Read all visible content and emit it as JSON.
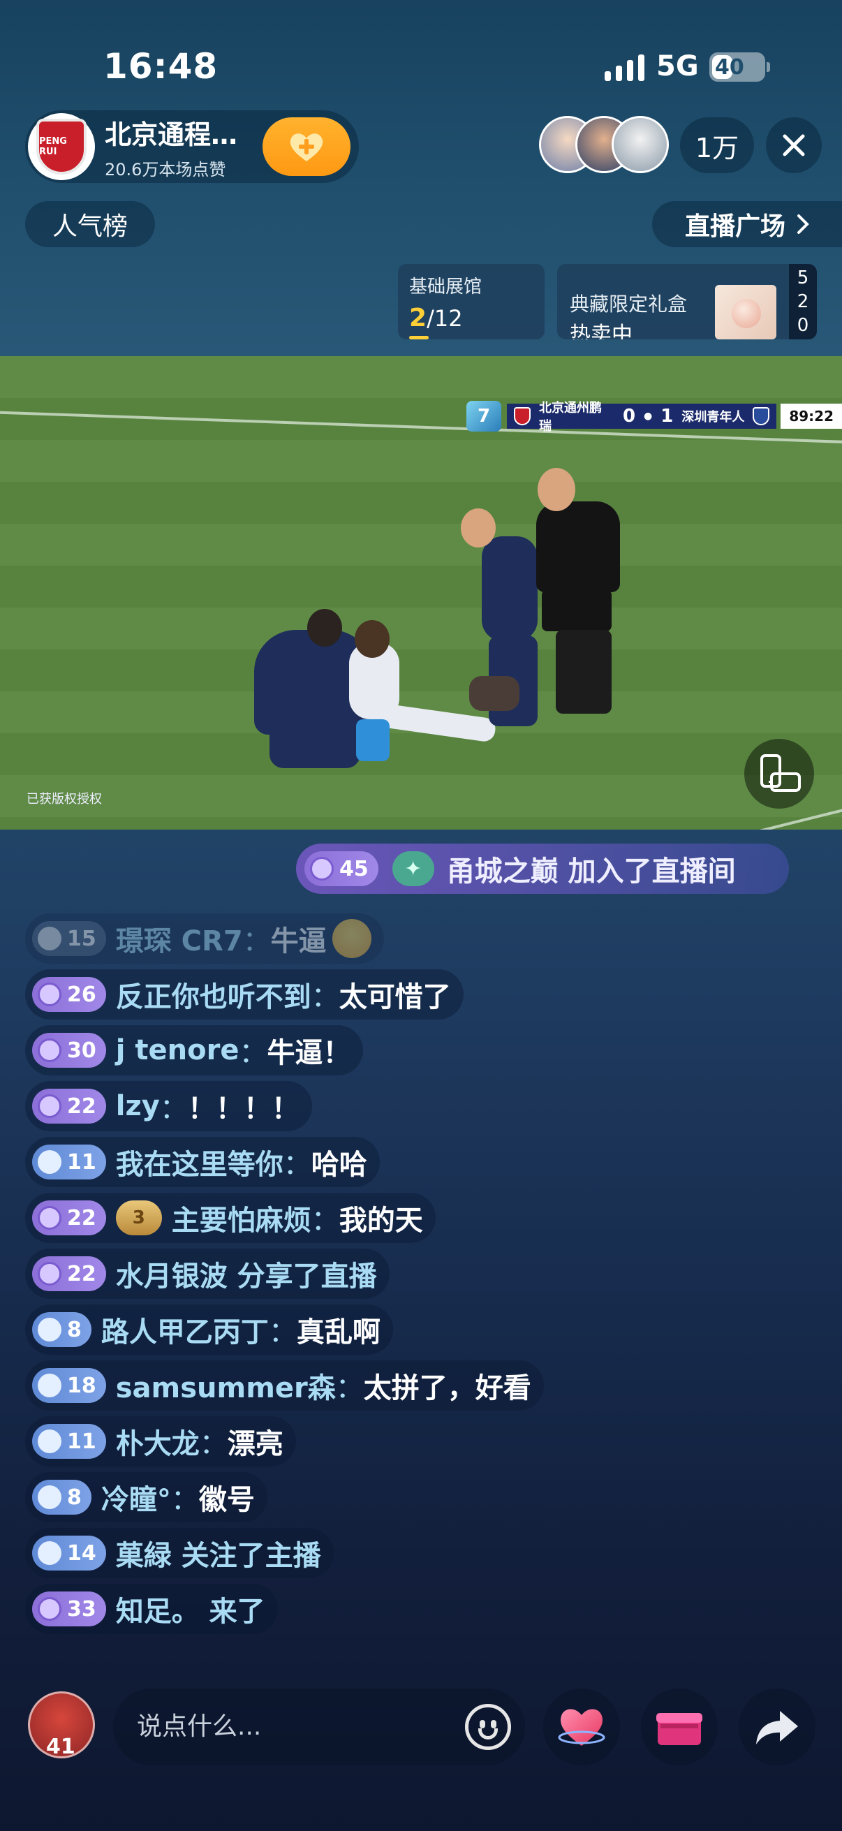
{
  "status": {
    "time": "16:48",
    "network": "5G",
    "battery": "40",
    "battery_level": 0.4
  },
  "host": {
    "name": "北京通程…",
    "likes": "20.6万本场点赞",
    "crest_text": "PENG RUI"
  },
  "viewers": {
    "count": "1万"
  },
  "nav": {
    "popularity": "人气榜",
    "plaza": "直播广场"
  },
  "hall_card": {
    "title": "基础展馆",
    "current": "2",
    "total": "/12"
  },
  "gift_card": {
    "title": "典藏限定礼盒",
    "status": "热卖中",
    "side": [
      "5",
      "2",
      "0"
    ]
  },
  "video": {
    "scorebug": {
      "home": "北京通州鹏瑞",
      "score_home": "0",
      "score_away": "1",
      "away": "深圳青年人",
      "clock": "89:22",
      "logo": "7"
    },
    "copyright": "已获版权授权"
  },
  "join_banner": {
    "level": "45",
    "text": "甬城之巅 加入了直播间"
  },
  "chat": [
    {
      "level": "15",
      "tier": "grey",
      "name": "璟琛 CR7",
      "sep": "：",
      "content": "牛逼",
      "faded": true
    },
    {
      "level": "26",
      "tier": "purple",
      "name": "反正你也听不到",
      "sep": "：",
      "content": "太可惜了"
    },
    {
      "level": "30",
      "tier": "purple",
      "name": "j tenore",
      "sep": "：",
      "content": "牛逼！"
    },
    {
      "level": "22",
      "tier": "purple",
      "name": "lzy",
      "sep": "：",
      "content": "！！！！"
    },
    {
      "level": "11",
      "tier": "blue",
      "name": "我在这里等你",
      "sep": "：",
      "content": "哈哈"
    },
    {
      "level": "22",
      "tier": "purple",
      "fan": "3",
      "name": "主要怕麻烦",
      "sep": "：",
      "content": "我的天"
    },
    {
      "level": "22",
      "tier": "purple",
      "name": "水月银波",
      "sep": "",
      "content": "",
      "system": " 分享了直播"
    },
    {
      "level": "8",
      "tier": "blue",
      "name": "路人甲乙丙丁",
      "sep": "：",
      "content": "真乱啊"
    },
    {
      "level": "18",
      "tier": "blue",
      "name": "samsummer森",
      "sep": "：",
      "content": "太拼了，好看"
    },
    {
      "level": "11",
      "tier": "blue",
      "name": "朴大龙",
      "sep": "：",
      "content": "漂亮"
    },
    {
      "level": "8",
      "tier": "blue",
      "name": "冷瞳°",
      "sep": "：",
      "content": "徽号"
    },
    {
      "level": "14",
      "tier": "blue",
      "name": "菓緑",
      "sep": "",
      "content": "",
      "system": " 关注了主播"
    },
    {
      "level": "33",
      "tier": "purple",
      "name": "知足。",
      "sep": "",
      "content": "",
      "system": " 来了"
    }
  ],
  "bottom": {
    "placeholder": "说点什么...",
    "my_count": "41"
  },
  "colors": {
    "accent": "#ff9913",
    "score_blue": "#1b2a6b",
    "name_blue": "#a9dcf4"
  }
}
